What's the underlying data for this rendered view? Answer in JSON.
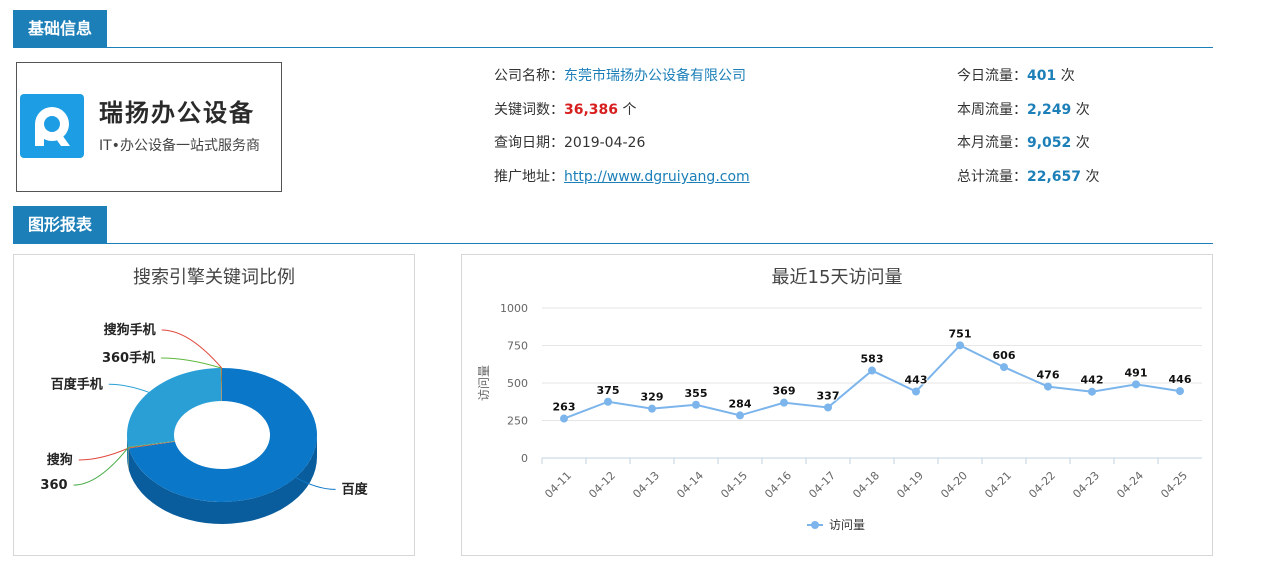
{
  "basic_info": {
    "section_title": "基础信息",
    "logo": {
      "name": "瑞扬办公设备",
      "slogan": "IT•办公设备一站式服务商",
      "icon": "ruiyang-logo-icon"
    },
    "company": {
      "label": "公司名称：",
      "value": "东莞市瑞扬办公设备有限公司"
    },
    "keywords": {
      "label": "关键词数：",
      "value": "36,386",
      "unit": "个"
    },
    "query_date": {
      "label": "查询日期：",
      "value": "2019-04-26"
    },
    "promo_url": {
      "label": "推广地址：",
      "value": "http://www.dgruiyang.com"
    },
    "traffic": {
      "today": {
        "label": "今日流量：",
        "value": "401",
        "unit": "次"
      },
      "week": {
        "label": "本周流量：",
        "value": "2,249",
        "unit": "次"
      },
      "month": {
        "label": "本月流量：",
        "value": "9,052",
        "unit": "次"
      },
      "total": {
        "label": "总计流量：",
        "value": "22,657",
        "unit": "次"
      }
    }
  },
  "charts_section": {
    "section_title": "图形报表"
  },
  "colors": {
    "accent": "#1c7fb8",
    "highlight_red": "#d71f1f",
    "line": "#7cb5ec"
  },
  "chart_data": [
    {
      "type": "pie",
      "title": "搜索引擎关键词比例",
      "categories": [
        "百度",
        "搜狗",
        "360",
        "百度手机",
        "360手机",
        "搜狗手机"
      ],
      "values": [
        71.8,
        0.2,
        0.2,
        27.6,
        0.1,
        0.1
      ],
      "colors": [
        "#0b77c8",
        "#e0473b",
        "#4cae4c",
        "#2a9fd6",
        "#5bb83c",
        "#e0473b"
      ]
    },
    {
      "type": "line",
      "title": "最近15天访问量",
      "ylabel": "访问量",
      "ylim": [
        0,
        1000
      ],
      "yticks": [
        0,
        250,
        500,
        750,
        1000
      ],
      "categories": [
        "04-11",
        "04-12",
        "04-13",
        "04-14",
        "04-15",
        "04-16",
        "04-17",
        "04-18",
        "04-19",
        "04-20",
        "04-21",
        "04-22",
        "04-23",
        "04-24",
        "04-25"
      ],
      "series": [
        {
          "name": "访问量",
          "values": [
            263,
            375,
            329,
            355,
            284,
            369,
            337,
            583,
            443,
            751,
            606,
            476,
            442,
            491,
            446
          ]
        }
      ],
      "legend": "bottom"
    }
  ]
}
